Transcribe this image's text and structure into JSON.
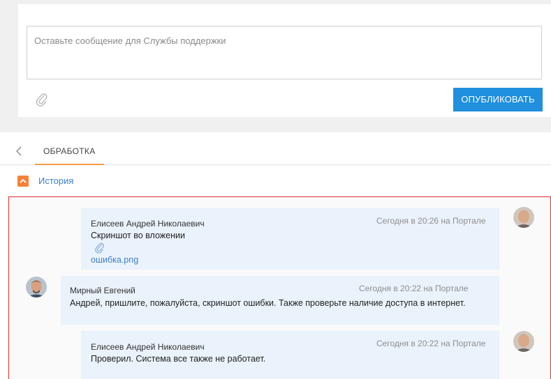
{
  "composer": {
    "placeholder": "Оставьте сообщение для Службы поддержки",
    "publish_label": "ОПУБЛИКОВАТЬ"
  },
  "tabs": {
    "active_label": "ОБРАБОТКА"
  },
  "history": {
    "label": "История"
  },
  "feed": {
    "messages": [
      {
        "author": "Елисеев Андрей Николаевич",
        "timestamp": "Сегодня в 20:26 на Портале",
        "text": "Скриншот во вложении",
        "attachment": "ошибка.png"
      },
      {
        "author": "Мирный Евгений",
        "timestamp": "Сегодня в 20:22 на Портале",
        "text": "Андрей, пришлите, пожалуйста, скриншот ошибки. Также проверьте наличие доступа в интернет."
      },
      {
        "author": "Елисеев Андрей Николаевич",
        "timestamp": "Сегодня в 20:22 на Портале",
        "text": "Проверил. Система все также не работает."
      }
    ]
  },
  "colors": {
    "publish_button": "#1f8fde",
    "tab_underline": "#f79b45",
    "history_toggle": "#f5823a",
    "link": "#3e7fc9",
    "highlight_border": "#e03030",
    "bubble": "#eaf2fb"
  }
}
